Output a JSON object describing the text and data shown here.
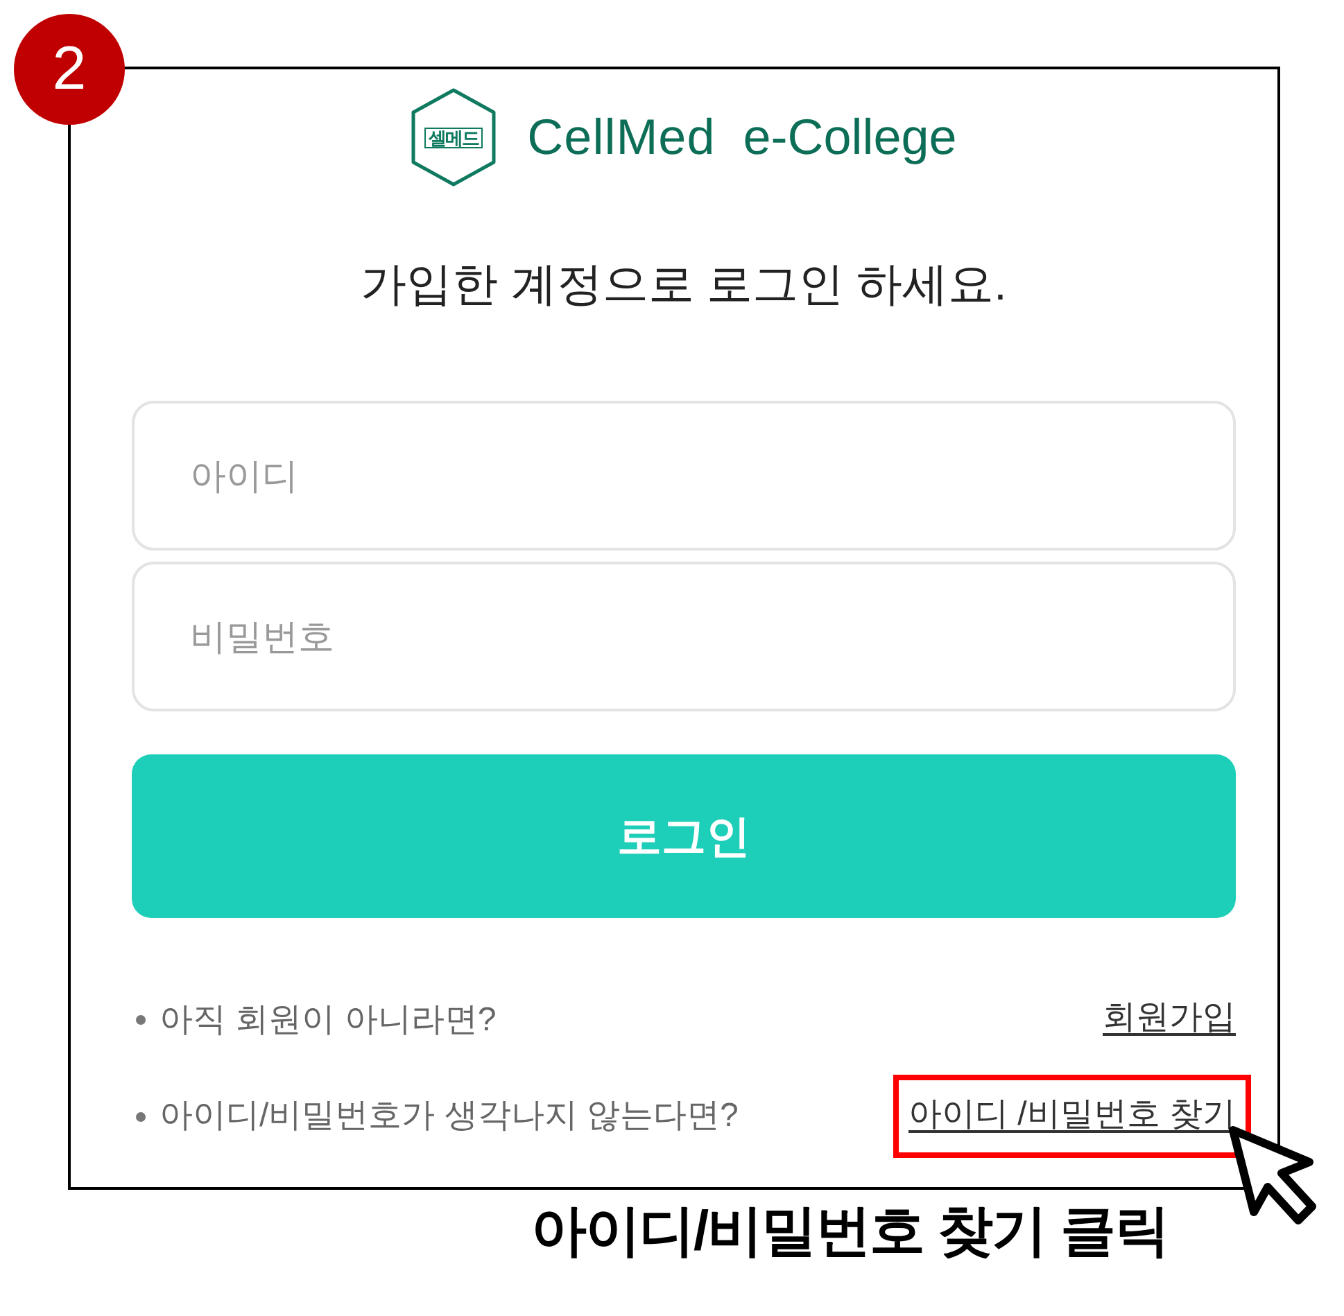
{
  "step_badge": "2",
  "logo": {
    "symbol_text": "셀메드",
    "brand": "CellMed",
    "product": "e-College"
  },
  "heading": "가입한 계정으로 로그인 하세요.",
  "fields": [
    {
      "placeholder": "아이디"
    },
    {
      "placeholder": "비밀번호"
    }
  ],
  "login_button": "로그인",
  "help_rows": [
    {
      "text": "아직 회원이 아니라면?",
      "link": "회원가입",
      "highlighted": false
    },
    {
      "text": "아이디/비밀번호가 생각나지 않는다면?",
      "link": "아이디 /비밀번호 찾기",
      "highlighted": true
    }
  ],
  "caption": "아이디/비밀번호 찾기 클릭"
}
